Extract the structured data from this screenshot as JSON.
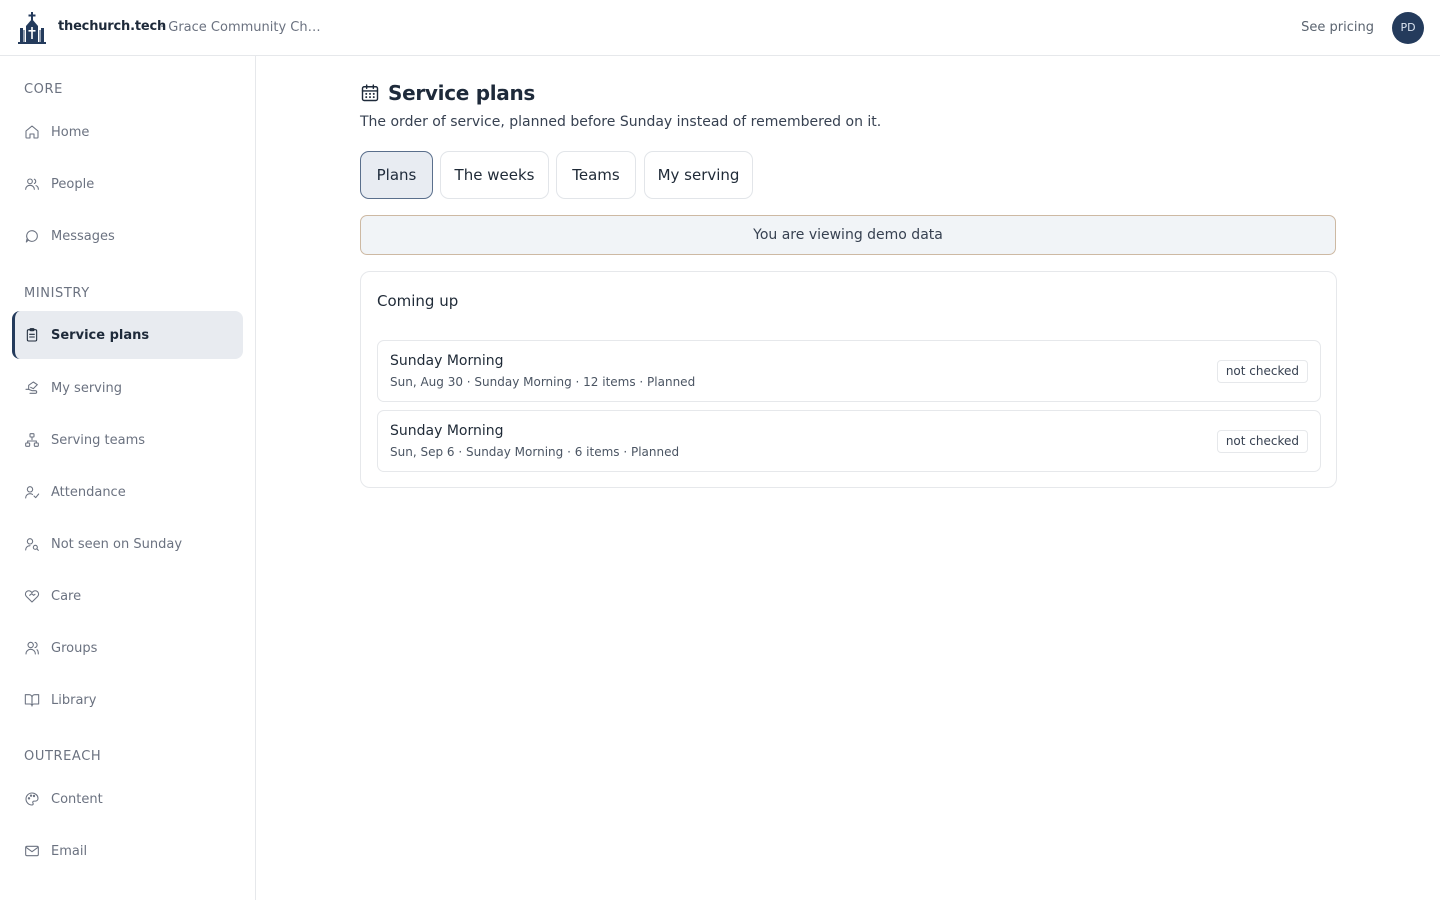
{
  "header": {
    "brand": "thechurch.tech",
    "org": "· Grace Community Church",
    "pricing": "See pricing",
    "avatar_initials": "PD"
  },
  "sidebar": {
    "sections": [
      {
        "label": "CORE"
      },
      {
        "label": "MINISTRY"
      },
      {
        "label": "OUTREACH"
      }
    ],
    "items": [
      {
        "label": "Home",
        "icon": "home-icon"
      },
      {
        "label": "People",
        "icon": "people-icon"
      },
      {
        "label": "Messages",
        "icon": "message-icon"
      },
      {
        "label": "Service plans",
        "icon": "clipboard-icon",
        "active": true
      },
      {
        "label": "My serving",
        "icon": "hand-icon"
      },
      {
        "label": "Serving teams",
        "icon": "org-chart-icon"
      },
      {
        "label": "Attendance",
        "icon": "user-check-icon"
      },
      {
        "label": "Not seen on Sunday",
        "icon": "user-search-icon"
      },
      {
        "label": "Care",
        "icon": "heart-handshake-icon"
      },
      {
        "label": "Groups",
        "icon": "users-icon"
      },
      {
        "label": "Library",
        "icon": "book-icon"
      },
      {
        "label": "Content",
        "icon": "palette-icon"
      },
      {
        "label": "Email",
        "icon": "mail-icon"
      }
    ]
  },
  "main": {
    "title": "Service plans",
    "subtitle": "The order of service, planned before Sunday instead of remembered on it.",
    "tabs": [
      {
        "label": "Plans",
        "active": true
      },
      {
        "label": "The weeks"
      },
      {
        "label": "Teams"
      },
      {
        "label": "My serving"
      }
    ],
    "demo_banner": "You are viewing demo data",
    "card": {
      "title": "Coming up",
      "rows": [
        {
          "title": "Sunday Morning",
          "meta": "Sun, Aug 30 · Sunday Morning · 12 items · Planned",
          "badge": "not checked"
        },
        {
          "title": "Sunday Morning",
          "meta": "Sun, Sep 6 · Sunday Morning · 6 items · Planned",
          "badge": "not checked"
        }
      ]
    }
  },
  "colors": {
    "accent": "#243b5c",
    "active_bg": "#e8ebf0",
    "banner_border": "#cdb9a3",
    "banner_bg": "#f1f4f7"
  }
}
